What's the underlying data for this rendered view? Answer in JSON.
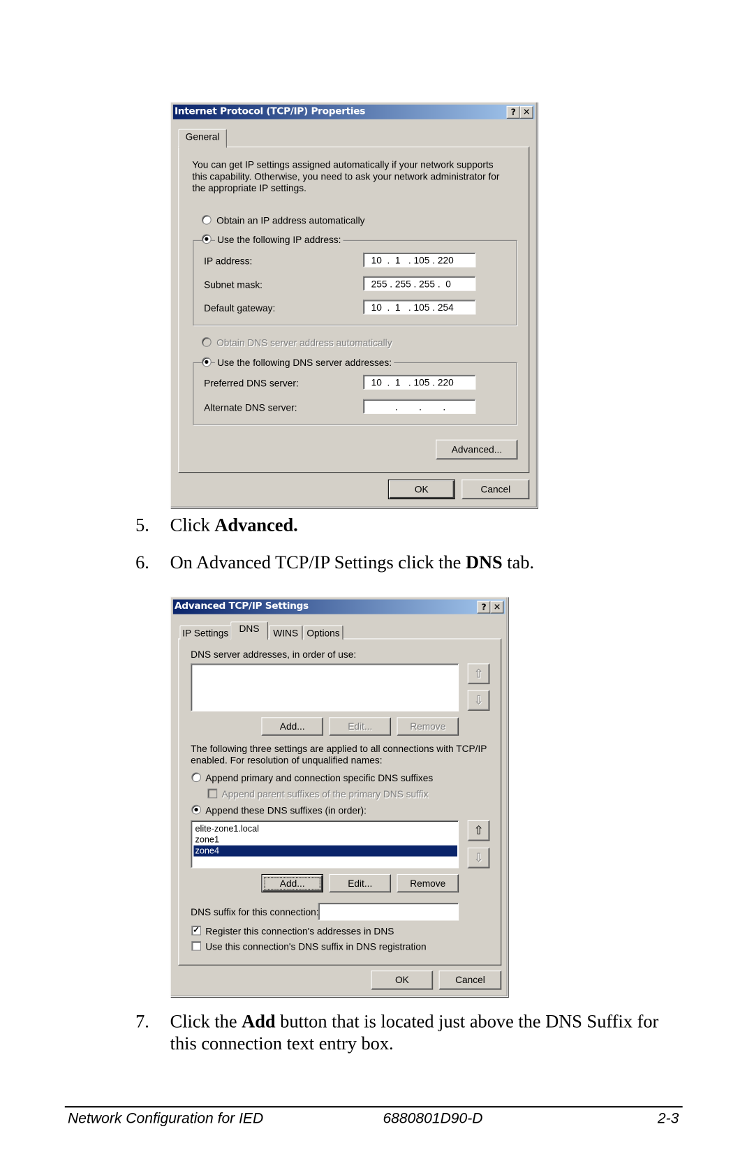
{
  "dialog1": {
    "title": "Internet Protocol (TCP/IP) Properties",
    "help_label": "?",
    "close_label": "✕",
    "tab": "General",
    "description": [
      "You can get IP settings assigned automatically if your network supports",
      "this capability. Otherwise, you need to ask your network administrator for",
      "the appropriate IP settings."
    ],
    "radio_obtain_ip": "Obtain an IP address automatically",
    "radio_use_ip": "Use the following IP address:",
    "ip_label": "IP address:",
    "ip_value": "10  .  1   . 105 . 220",
    "subnet_label": "Subnet mask:",
    "subnet_value": "255 . 255 . 255 .  0",
    "gateway_label": "Default gateway:",
    "gateway_value": "10  .  1   . 105 . 254",
    "radio_obtain_dns": "Obtain DNS server address automatically",
    "radio_use_dns": "Use the following DNS server addresses:",
    "preferred_label": "Preferred DNS server:",
    "preferred_value": "10  .  1   . 105 . 220",
    "alternate_label": "Alternate DNS server:",
    "alternate_value": "         .        .        .",
    "advanced": "Advanced...",
    "ok": "OK",
    "cancel": "Cancel"
  },
  "steps": [
    {
      "num": "5.",
      "text": "Click ",
      "bold": "Advanced.",
      "after": ""
    },
    {
      "num": "6.",
      "text": "On Advanced TCP/IP Settings click the ",
      "bold": "DNS",
      "after": " tab."
    },
    {
      "num": "7.",
      "text": "Click the ",
      "bold": "Add",
      "after": " button that is located just above the DNS Suffix for",
      "line2": "this connection text entry box."
    }
  ],
  "dialog2": {
    "title": "Advanced TCP/IP Settings",
    "tabs": [
      "IP Settings",
      "DNS",
      "WINS",
      "Options"
    ],
    "active_tab": "DNS",
    "dns_servers_label": "DNS server addresses, in order of use:",
    "add": "Add...",
    "edit": "Edit...",
    "remove": "Remove",
    "info": [
      "The following three settings are applied to all connections with TCP/IP",
      "enabled. For resolution of unqualified names:"
    ],
    "radio_append_primary": "Append primary and connection specific DNS suffixes",
    "chk_append_parent": "Append parent suffixes of the primary DNS suffix",
    "radio_append_these": "Append these DNS suffixes (in order):",
    "suffixes": [
      "elite-zone1.local",
      "zone1",
      "zone4"
    ],
    "selected_suffix": "zone4",
    "suffix_label": "DNS suffix for this connection:",
    "suffix_value": "",
    "chk_register": "Register this connection's addresses in DNS",
    "chk_use_suffix": "Use this connection's DNS suffix in DNS registration",
    "ok": "OK",
    "cancel": "Cancel",
    "up_icon": "⇧",
    "down_icon": "⇩"
  },
  "footer": {
    "left": "Network Configuration for IED",
    "center": "6880801D90-D",
    "right": "2-3"
  },
  "colors": {
    "titlebar_start": "#0a246a",
    "titlebar_end": "#a6caf0",
    "dialog_bg": "#d4d0c8",
    "selection": "#0a246a"
  }
}
